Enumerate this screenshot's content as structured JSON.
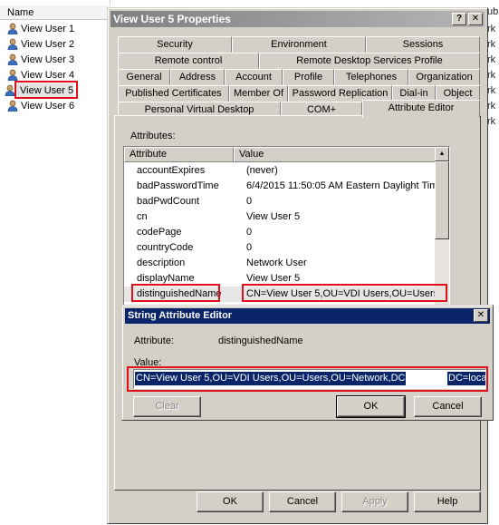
{
  "background_list": {
    "header": "Name",
    "users": [
      "View User 1",
      "View User 2",
      "View User 3",
      "View User 4",
      "View User 5",
      "View User 6"
    ],
    "selected_index": 4,
    "right_fragments": [
      "ub",
      "rk",
      "rk",
      "rk",
      "rk",
      "rk",
      "rk",
      "rk"
    ]
  },
  "dialog": {
    "title": "View User 5 Properties",
    "help_glyph": "?",
    "close_glyph": "✕",
    "tabs": {
      "row1": [
        "Security",
        "Environment",
        "Sessions"
      ],
      "row2": [
        "Remote control",
        "Remote Desktop Services Profile"
      ],
      "row3": [
        "General",
        "Address",
        "Account",
        "Profile",
        "Telephones",
        "Organization"
      ],
      "row4": [
        "Published Certificates",
        "Member Of",
        "Password Replication",
        "Dial-in",
        "Object"
      ],
      "row5": [
        "Personal Virtual Desktop",
        "COM+",
        "Attribute Editor"
      ]
    },
    "active_tab": "Attribute Editor",
    "attributes_label": "Attributes:",
    "columns": [
      "Attribute",
      "Value"
    ],
    "rows": [
      {
        "attribute": "accountExpires",
        "value": "(never)"
      },
      {
        "attribute": "badPasswordTime",
        "value": "6/4/2015 11:50:05 AM Eastern Daylight Tim"
      },
      {
        "attribute": "badPwdCount",
        "value": "0"
      },
      {
        "attribute": "cn",
        "value": "View User 5"
      },
      {
        "attribute": "codePage",
        "value": "0"
      },
      {
        "attribute": "countryCode",
        "value": "0"
      },
      {
        "attribute": "description",
        "value": "Network User"
      },
      {
        "attribute": "displayName",
        "value": "View User 5"
      },
      {
        "attribute": "distinguishedName",
        "value": "CN=View User 5,OU=VDI Users,OU=Users,C"
      }
    ],
    "buttons": {
      "ok": "OK",
      "cancel": "Cancel",
      "apply": "Apply",
      "help": "Help"
    }
  },
  "string_editor": {
    "title": "String Attribute Editor",
    "close_glyph": "✕",
    "attribute_label": "Attribute:",
    "attribute_value": "distinguishedName",
    "value_label": "Value:",
    "value_part1": "CN=View User 5,OU=VDI Users,OU=Users,OU=Network,DC",
    "value_part2": "DC=loca",
    "buttons": {
      "clear": "Clear",
      "ok": "OK",
      "cancel": "Cancel"
    }
  },
  "colors": {
    "highlight_box": "#e0101a",
    "selection": "#0a246a",
    "dialog_face": "#d4d0c8",
    "inactive_title": "#808080"
  }
}
